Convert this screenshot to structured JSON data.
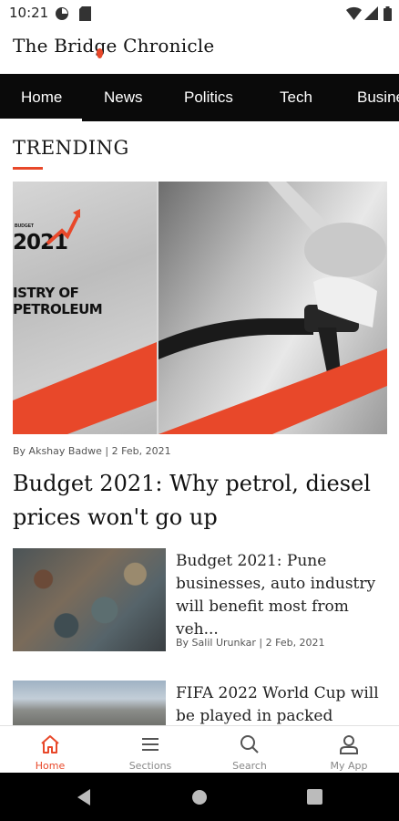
{
  "status_bar": {
    "time": "10:21"
  },
  "app": {
    "logo_part1": "The Brid",
    "logo_g": "g",
    "logo_part2": "e Chronicle"
  },
  "nav": {
    "tabs": [
      {
        "label": "Home",
        "active": true
      },
      {
        "label": "News"
      },
      {
        "label": "Politics"
      },
      {
        "label": "Tech"
      },
      {
        "label": "Busine"
      }
    ]
  },
  "section": {
    "title": "TRENDING"
  },
  "hero": {
    "image_text_small": "BUDGET",
    "image_text_year": "2021",
    "image_text_ministry": "ISTRY OF PETROLEUM",
    "byline": "By Akshay Badwe | 2 Feb, 2021",
    "headline": "Budget 2021: Why petrol, diesel prices won't go up"
  },
  "articles": [
    {
      "title": "Budget 2021: Pune businesses, auto industry will benefit most from veh...",
      "byline": "By Salil Urunkar | 2 Feb, 2021"
    },
    {
      "title": "FIFA 2022 World Cup will be played in packed"
    }
  ],
  "bottom_nav": {
    "items": [
      {
        "label": "Home",
        "icon": "home-icon",
        "active": true
      },
      {
        "label": "Sections",
        "icon": "menu-icon"
      },
      {
        "label": "Search",
        "icon": "search-icon"
      },
      {
        "label": "My App",
        "icon": "profile-icon"
      }
    ]
  },
  "colors": {
    "accent": "#e8482a",
    "nav_bg": "#0a0a0a"
  }
}
